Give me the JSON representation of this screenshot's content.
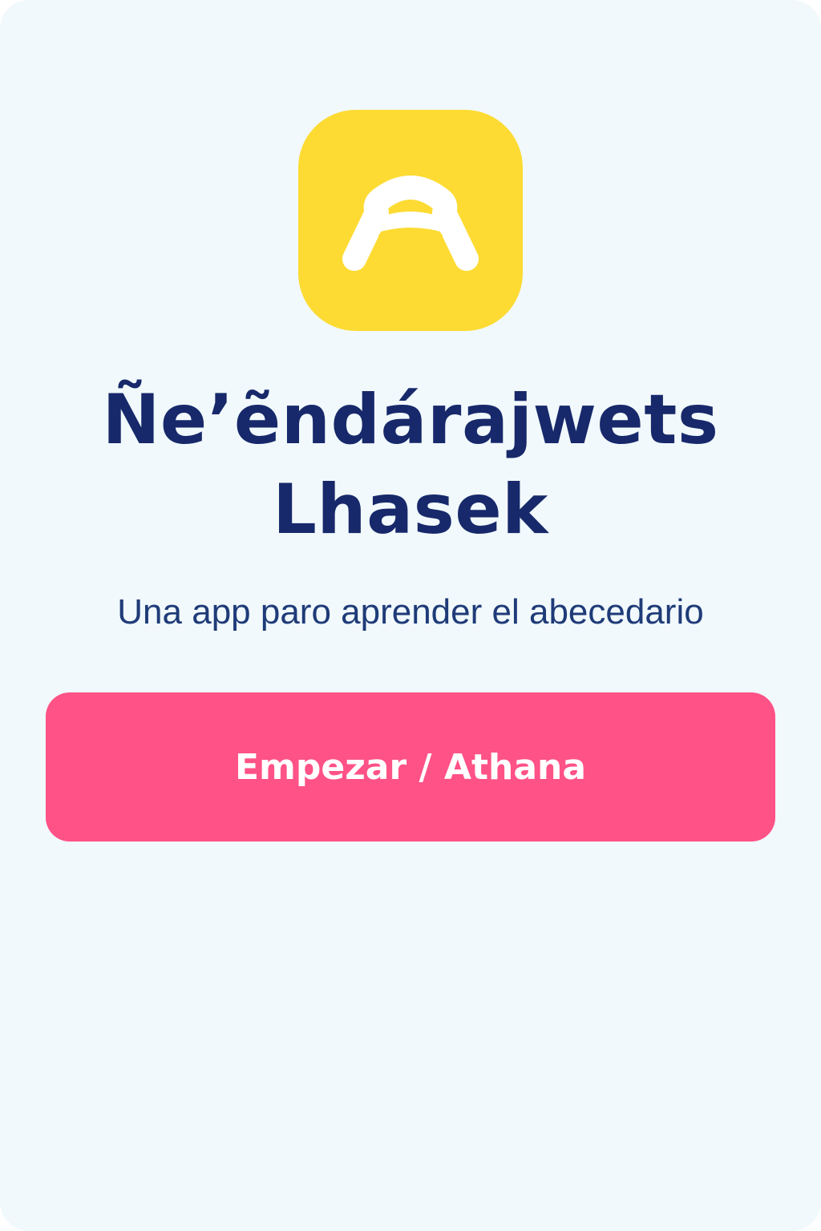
{
  "app": {
    "icon_name": "arch-logo-icon",
    "icon_color": "#fddb33",
    "title_line1": "Ñe’ẽndárajwets",
    "title_line2": "Lhasek",
    "subtitle": "Una app paro aprender el abecedario"
  },
  "actions": {
    "start_label": "Empezar / Athana",
    "start_color": "#ff5286"
  },
  "colors": {
    "background": "#f1f9fc",
    "title": "#17296a",
    "subtitle": "#1f3b78"
  }
}
